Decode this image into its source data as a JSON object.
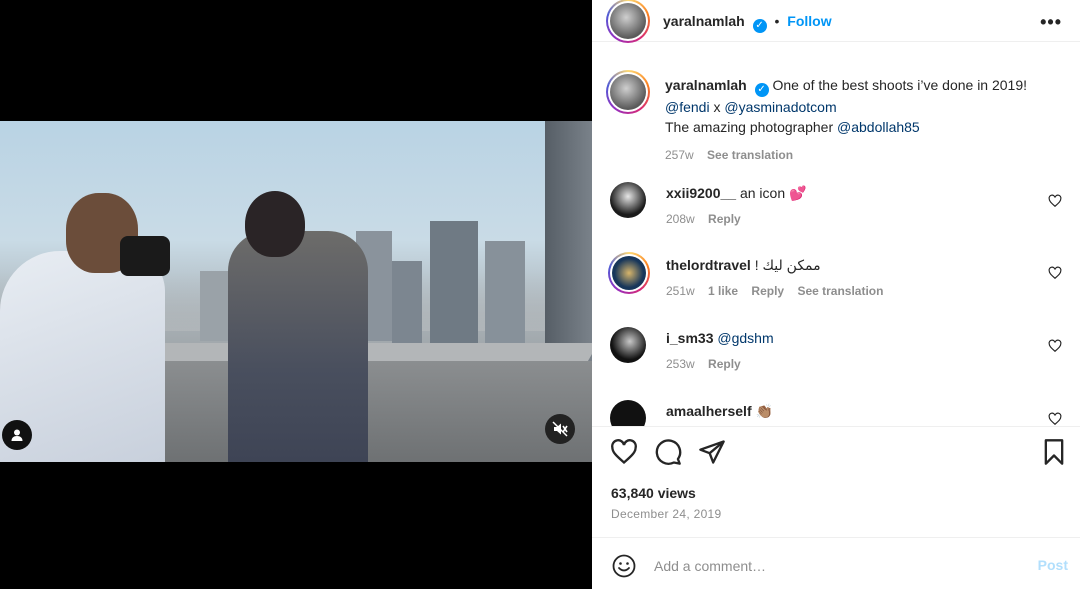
{
  "post": {
    "author": "yaralnamlah",
    "follow_label": "Follow",
    "more_label": "•••",
    "verified_mark": "✓"
  },
  "caption": {
    "username": "yaralnamlah",
    "text_1": "One of the best shoots i’ve done in 2019!",
    "mention_fendi": "@fendi",
    "x_sep": " x ",
    "mention_yasmina": "@yasminadotcom",
    "text_2": "The amazing photographer ",
    "mention_photographer": "@abdollah85",
    "time": "257w",
    "see_translation": "See translation"
  },
  "comments": [
    {
      "username": "xxii9200__",
      "text": "an icon 💕",
      "time": "208w",
      "reply": "Reply"
    },
    {
      "username": "thelordtravel",
      "text": "ممكن ليك !",
      "time": "251w",
      "likes": "1 like",
      "reply": "Reply",
      "see_translation": "See translation"
    },
    {
      "username": "i_sm33",
      "text": "@gdshm",
      "time": "253w",
      "reply": "Reply"
    },
    {
      "username": "amaalherself",
      "text": "👏🏽"
    }
  ],
  "stats": {
    "views": "63,840 views",
    "date": "December 24, 2019"
  },
  "composer": {
    "placeholder": "Add a comment…",
    "post_label": "Post"
  },
  "colors": {
    "link": "#00376b",
    "accent": "#0095f6",
    "muted": "#8e8e8e"
  },
  "icons": [
    "user-tag-icon",
    "mute-icon",
    "more-icon",
    "heart-icon",
    "comment-icon",
    "share-icon",
    "bookmark-icon",
    "emoji-icon",
    "verified-icon"
  ]
}
